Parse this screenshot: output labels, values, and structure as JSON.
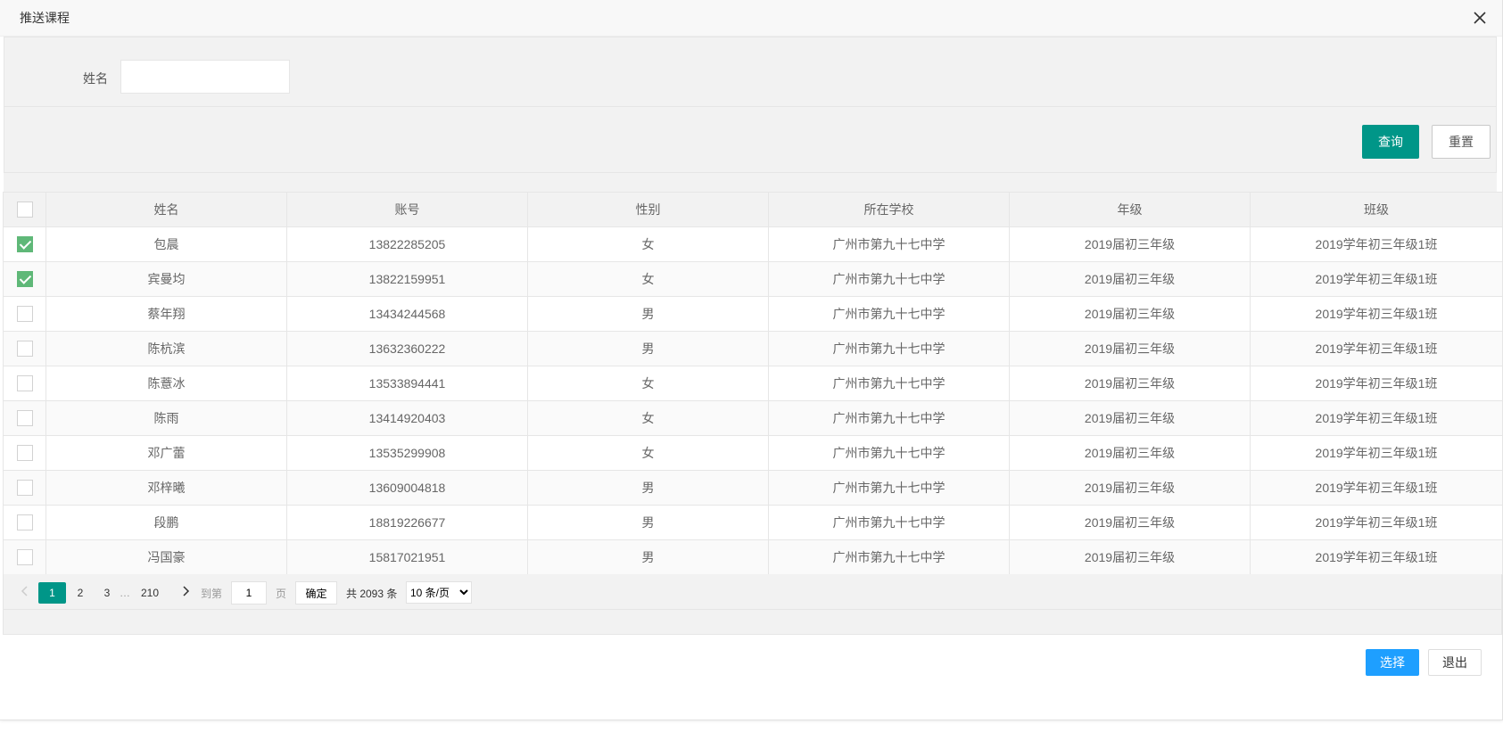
{
  "dialog": {
    "title": "推送课程"
  },
  "search": {
    "name_label": "姓名",
    "name_value": "",
    "name_placeholder": ""
  },
  "buttons": {
    "query": "查询",
    "reset": "重置",
    "select": "选择",
    "exit": "退出"
  },
  "table": {
    "headers": [
      "姓名",
      "账号",
      "性别",
      "所在学校",
      "年级",
      "班级"
    ],
    "rows": [
      {
        "checked": true,
        "name": "包晨",
        "account": "13822285205",
        "gender": "女",
        "school": "广州市第九十七中学",
        "grade": "2019届初三年级",
        "class": "2019学年初三年级1班"
      },
      {
        "checked": true,
        "name": "宾曼均",
        "account": "13822159951",
        "gender": "女",
        "school": "广州市第九十七中学",
        "grade": "2019届初三年级",
        "class": "2019学年初三年级1班"
      },
      {
        "checked": false,
        "name": "蔡年翔",
        "account": "13434244568",
        "gender": "男",
        "school": "广州市第九十七中学",
        "grade": "2019届初三年级",
        "class": "2019学年初三年级1班"
      },
      {
        "checked": false,
        "name": "陈杭滨",
        "account": "13632360222",
        "gender": "男",
        "school": "广州市第九十七中学",
        "grade": "2019届初三年级",
        "class": "2019学年初三年级1班"
      },
      {
        "checked": false,
        "name": "陈薏冰",
        "account": "13533894441",
        "gender": "女",
        "school": "广州市第九十七中学",
        "grade": "2019届初三年级",
        "class": "2019学年初三年级1班"
      },
      {
        "checked": false,
        "name": "陈雨",
        "account": "13414920403",
        "gender": "女",
        "school": "广州市第九十七中学",
        "grade": "2019届初三年级",
        "class": "2019学年初三年级1班"
      },
      {
        "checked": false,
        "name": "邓广蕾",
        "account": "13535299908",
        "gender": "女",
        "school": "广州市第九十七中学",
        "grade": "2019届初三年级",
        "class": "2019学年初三年级1班"
      },
      {
        "checked": false,
        "name": "邓梓曦",
        "account": "13609004818",
        "gender": "男",
        "school": "广州市第九十七中学",
        "grade": "2019届初三年级",
        "class": "2019学年初三年级1班"
      },
      {
        "checked": false,
        "name": "段鹏",
        "account": "18819226677",
        "gender": "男",
        "school": "广州市第九十七中学",
        "grade": "2019届初三年级",
        "class": "2019学年初三年级1班"
      },
      {
        "checked": false,
        "name": "冯国豪",
        "account": "15817021951",
        "gender": "男",
        "school": "广州市第九十七中学",
        "grade": "2019届初三年级",
        "class": "2019学年初三年级1班"
      }
    ]
  },
  "pager": {
    "pages": [
      "1",
      "2",
      "3"
    ],
    "ellipsis": "…",
    "last_page": "210",
    "goto_label": "到第",
    "goto_value": "1",
    "page_unit": "页",
    "confirm": "确定",
    "total": "共 2093 条",
    "page_size": "10 条/页"
  },
  "colors": {
    "primary": "#009688",
    "checked": "#5fb878",
    "select_button": "#1e9fff"
  }
}
